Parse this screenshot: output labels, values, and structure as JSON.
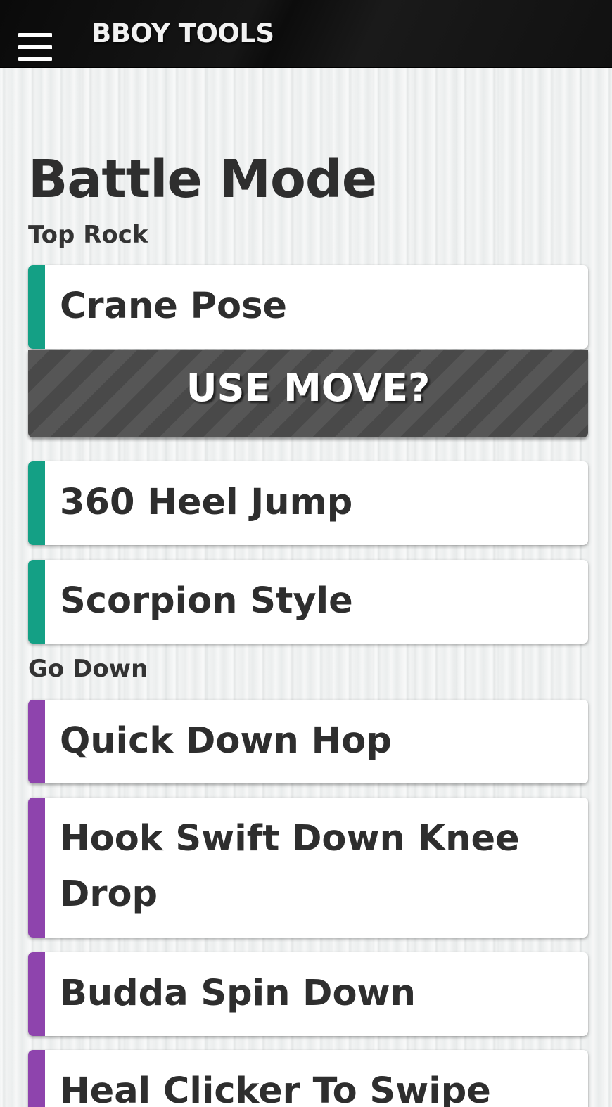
{
  "header": {
    "app_title": "BBOY TOOLS",
    "menu_icon": "hamburger-menu-icon"
  },
  "page": {
    "title": "Battle Mode"
  },
  "colors": {
    "top_rock_accent": "#14a085",
    "go_down_accent": "#8e44ad",
    "use_move_bg": "#4d4d4d"
  },
  "sections": [
    {
      "label": "Top Rock",
      "moves": [
        {
          "name": "Crane Pose",
          "expanded": true,
          "action_label": "USE MOVE?"
        },
        {
          "name": "360 Heel Jump"
        },
        {
          "name": "Scorpion Style"
        }
      ]
    },
    {
      "label": "Go Down",
      "moves": [
        {
          "name": "Quick Down Hop"
        },
        {
          "name": "Hook Swift Down Knee Drop"
        },
        {
          "name": "Budda Spin Down"
        },
        {
          "name": "Heal Clicker To Swipe"
        }
      ]
    }
  ]
}
